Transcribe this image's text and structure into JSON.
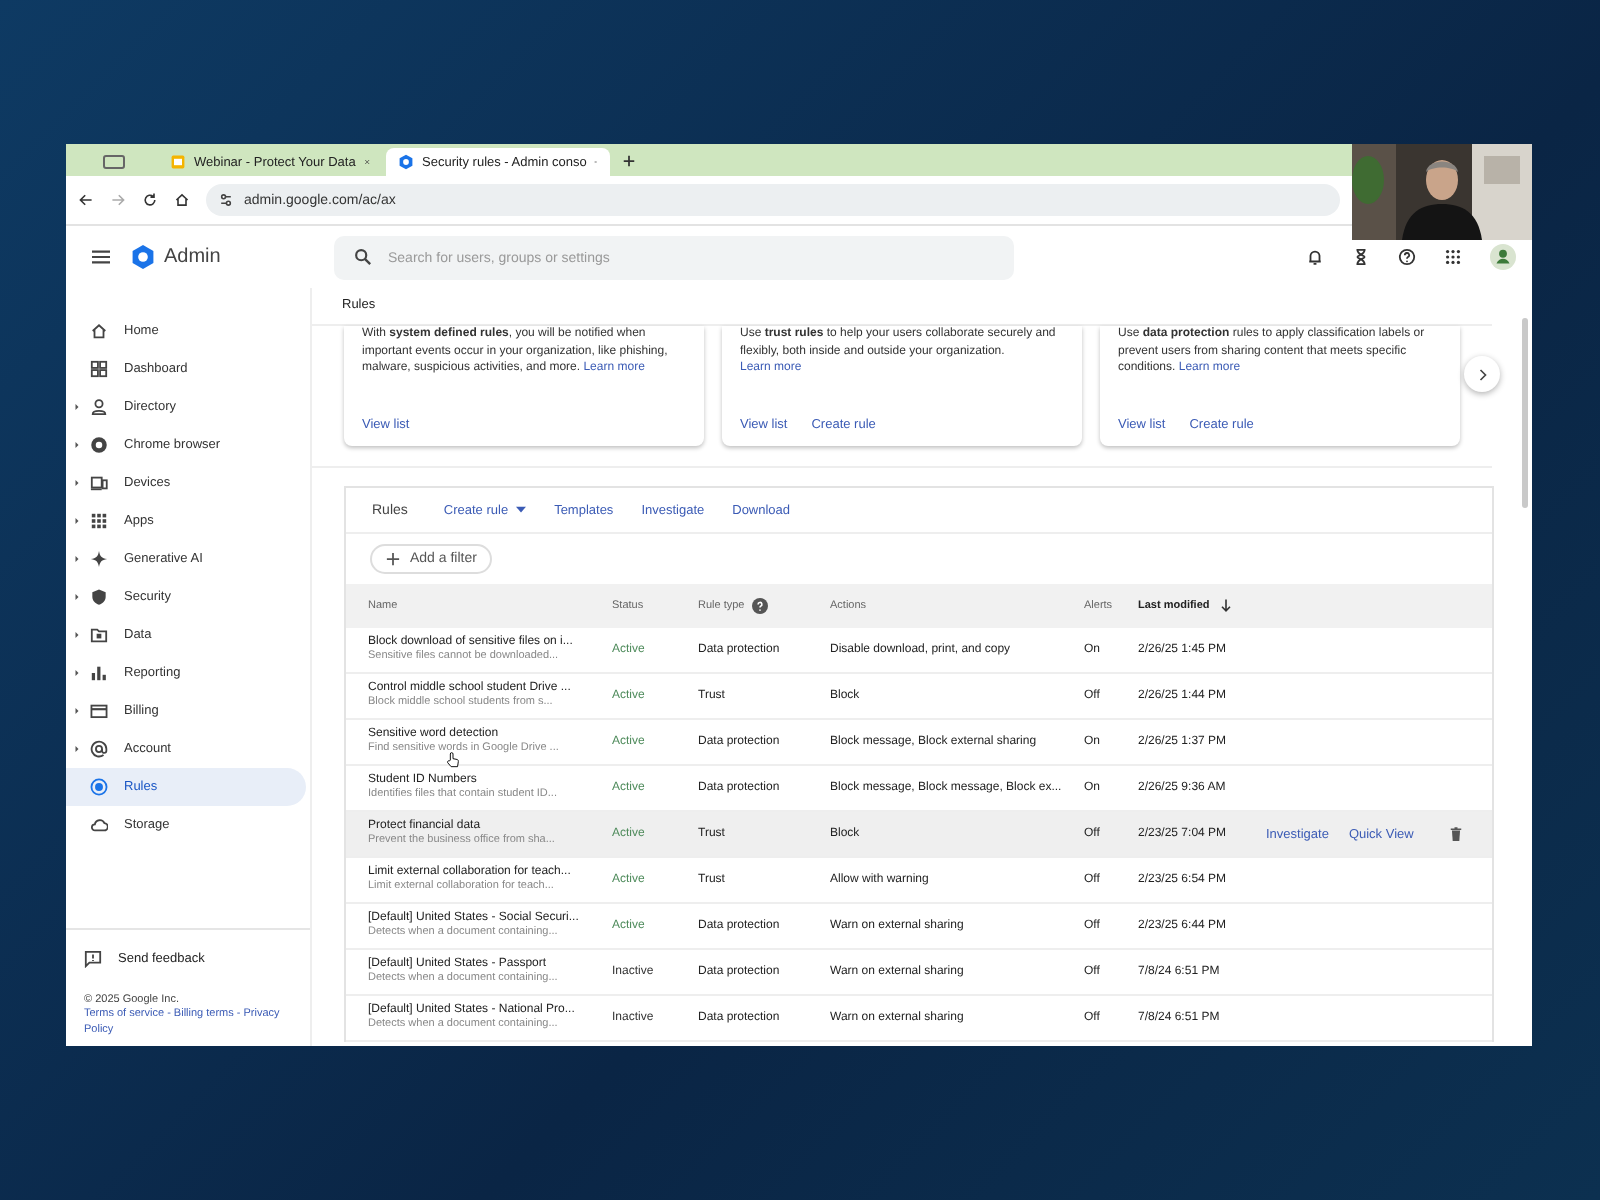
{
  "browser": {
    "tabs": [
      {
        "kind": "pinned",
        "selected": false
      },
      {
        "title": "Webinar - Protect Your Data",
        "kind": "slides",
        "selected": false
      },
      {
        "title": "Security rules - Admin conso",
        "kind": "admin",
        "selected": true
      }
    ],
    "address": "admin.google.com/ac/ax"
  },
  "header": {
    "app_name": "Admin",
    "search": {
      "placeholder": "Search for users, groups or settings"
    }
  },
  "sidebar": {
    "items": [
      {
        "label": "Home",
        "expandable": false,
        "selected": false
      },
      {
        "label": "Dashboard",
        "expandable": false,
        "selected": false
      },
      {
        "label": "Directory",
        "expandable": true,
        "selected": false
      },
      {
        "label": "Chrome browser",
        "expandable": true,
        "selected": false
      },
      {
        "label": "Devices",
        "expandable": true,
        "selected": false
      },
      {
        "label": "Apps",
        "expandable": true,
        "selected": false
      },
      {
        "label": "Generative AI",
        "expandable": true,
        "selected": false
      },
      {
        "label": "Security",
        "expandable": true,
        "selected": false
      },
      {
        "label": "Data",
        "expandable": true,
        "selected": false
      },
      {
        "label": "Reporting",
        "expandable": true,
        "selected": false
      },
      {
        "label": "Billing",
        "expandable": true,
        "selected": false
      },
      {
        "label": "Account",
        "expandable": true,
        "selected": false
      },
      {
        "label": "Rules",
        "expandable": false,
        "selected": true
      },
      {
        "label": "Storage",
        "expandable": false,
        "selected": false
      }
    ],
    "feedback": "Send feedback",
    "copyright": "© 2025 Google Inc.",
    "legal": "Terms of service - Billing terms - Privacy Policy"
  },
  "breadcrumb": "Rules",
  "cards": [
    {
      "text": "With **system defined rules**, you will be notified when important events occur in your organization, like phishing, malware, suspicious activities, and more.",
      "learn_more": "Learn more",
      "links": [
        "View list"
      ]
    },
    {
      "text": "Use **trust rules** to help your users collaborate securely and flexibly, both inside and outside your organization.",
      "learn_more": "Learn more",
      "links": [
        "View list",
        "Create rule"
      ]
    },
    {
      "text": "Use **data protection** rules to apply classification labels or prevent users from sharing content that meets specific conditions.",
      "learn_more": "Learn more",
      "links": [
        "View list",
        "Create rule"
      ]
    }
  ],
  "rules": {
    "title": "Rules",
    "toolbar": [
      {
        "label": "Create rule",
        "kind": "menu"
      },
      {
        "label": "Templates",
        "kind": "link"
      },
      {
        "label": "Investigate",
        "kind": "link"
      },
      {
        "label": "Download",
        "kind": "link"
      }
    ],
    "add_filter": "Add a filter",
    "columns": [
      "Name",
      "Status",
      "Rule type",
      "Actions",
      "Alerts",
      "Last modified"
    ],
    "hover_actions": [
      "Investigate",
      "Quick View"
    ],
    "rows": [
      {
        "name": "Block download of sensitive files on i...",
        "description": "Sensitive files cannot be downloaded...",
        "status": "Active",
        "active": true,
        "rule_type": "Data protection",
        "actions": "Disable download, print, and copy",
        "alerts": "On",
        "modified": "2/26/25 1:45 PM",
        "hovered": false
      },
      {
        "name": "Control middle school student Drive ...",
        "description": "Block middle school students from s...",
        "status": "Active",
        "active": true,
        "rule_type": "Trust",
        "actions": "Block",
        "alerts": "Off",
        "modified": "2/26/25 1:44 PM",
        "hovered": false
      },
      {
        "name": "Sensitive word detection",
        "description": "Find sensitive words in Google Drive ...",
        "status": "Active",
        "active": true,
        "rule_type": "Data protection",
        "actions": "Block message, Block external sharing",
        "alerts": "On",
        "modified": "2/26/25 1:37 PM",
        "hovered": false
      },
      {
        "name": "Student ID Numbers",
        "description": "Identifies files that contain student ID...",
        "status": "Active",
        "active": true,
        "rule_type": "Data protection",
        "actions": "Block message, Block message, Block ex...",
        "alerts": "On",
        "modified": "2/26/25 9:36 AM",
        "hovered": false
      },
      {
        "name": "Protect financial data",
        "description": "Prevent the business office from sha...",
        "status": "Active",
        "active": true,
        "rule_type": "Trust",
        "actions": "Block",
        "alerts": "Off",
        "modified": "2/23/25 7:04 PM",
        "hovered": true
      },
      {
        "name": "Limit external collaboration for teach...",
        "description": "Limit external collaboration for teach...",
        "status": "Active",
        "active": true,
        "rule_type": "Trust",
        "actions": "Allow with warning",
        "alerts": "Off",
        "modified": "2/23/25 6:54 PM",
        "hovered": false
      },
      {
        "name": "[Default] United States - Social Securi...",
        "description": "Detects when a document containing...",
        "status": "Active",
        "active": true,
        "rule_type": "Data protection",
        "actions": "Warn on external sharing",
        "alerts": "Off",
        "modified": "2/23/25 6:44 PM",
        "hovered": false
      },
      {
        "name": "[Default] United States - Passport",
        "description": "Detects when a document containing...",
        "status": "Inactive",
        "active": false,
        "rule_type": "Data protection",
        "actions": "Warn on external sharing",
        "alerts": "Off",
        "modified": "7/8/24 6:51 PM",
        "hovered": false
      },
      {
        "name": "[Default] United States - National Pro...",
        "description": "Detects when a document containing...",
        "status": "Inactive",
        "active": false,
        "rule_type": "Data protection",
        "actions": "Warn on external sharing",
        "alerts": "Off",
        "modified": "7/8/24 6:51 PM",
        "hovered": false
      }
    ]
  }
}
